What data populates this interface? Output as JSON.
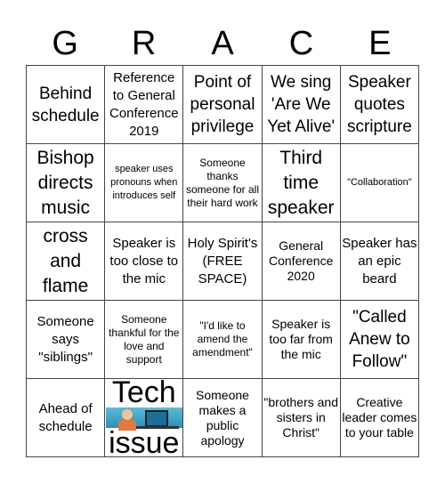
{
  "title_letters": [
    "G",
    "R",
    "A",
    "C",
    "E"
  ],
  "cells": [
    [
      "Behind schedule",
      "Reference to General Conference 2019",
      "Point of personal privilege",
      "We sing 'Are We Yet Alive'",
      "Speaker quotes scripture"
    ],
    [
      "Bishop directs music",
      "speaker uses pronouns when introduces self",
      "Someone thanks someone for all their hard work",
      "Third time speaker",
      "\"Collaboration\""
    ],
    [
      "cross and flame",
      "Speaker is too close to the mic",
      "Holy Spirit's (FREE SPACE)",
      "General Conference 2020",
      "Speaker has an epic beard"
    ],
    [
      "Someone says \"siblings\"",
      "Someone thankful for the love and support",
      "\"I'd like to amend the amendment\"",
      "Speaker is too far from the mic",
      "\"Called Anew to Follow\""
    ],
    [
      "Ahead of schedule",
      "Tech issue",
      "Someone makes a public apology",
      "\"brothers and sisters in Christ\"",
      "Creative leader comes to your table"
    ]
  ],
  "tech_issue": {
    "top": "Tech",
    "bottom": "issue",
    "image": "frustrated-computer-user-icon"
  }
}
